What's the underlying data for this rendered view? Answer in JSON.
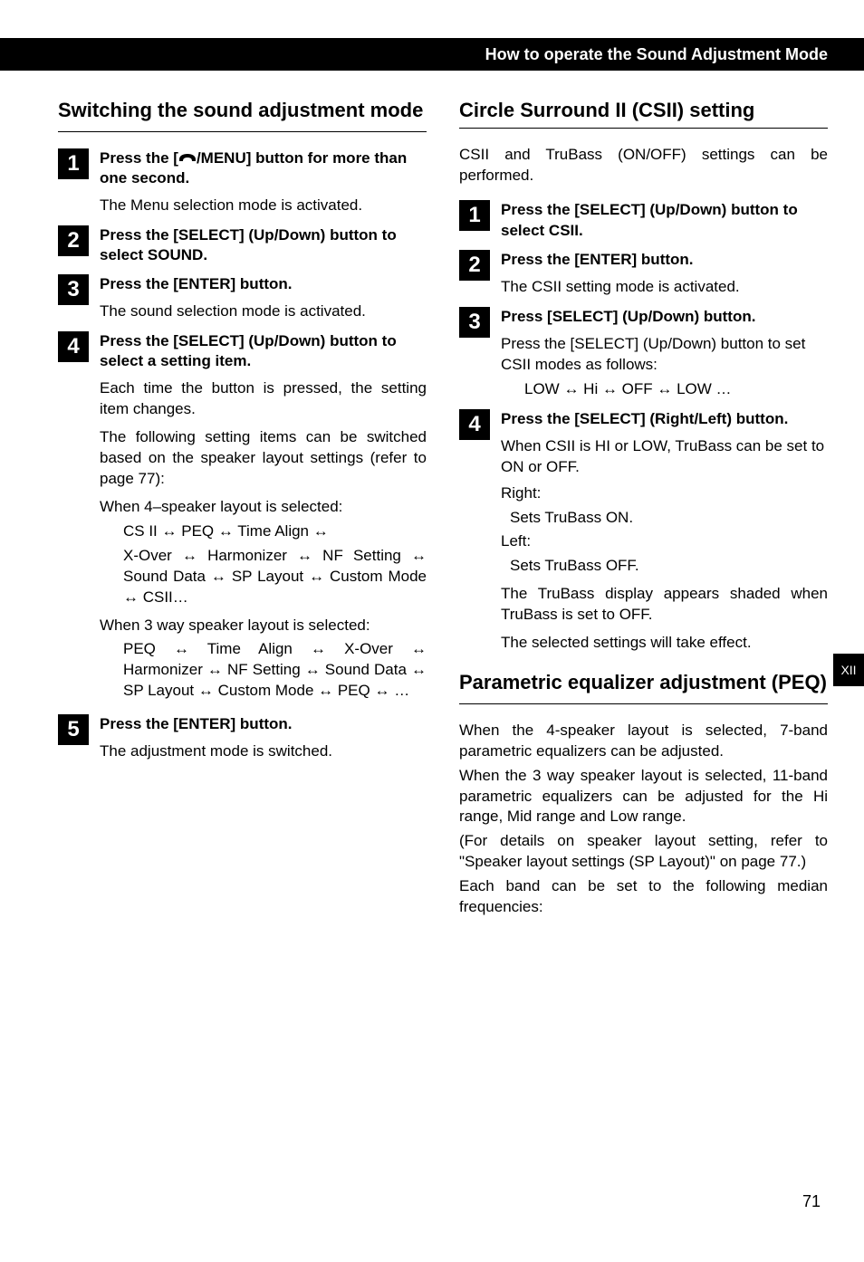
{
  "header": {
    "title": "How to operate the Sound Adjustment Mode"
  },
  "left": {
    "heading": "Switching the sound adjustment mode",
    "steps": {
      "s1": {
        "num": "1",
        "title_pre": "Press the [",
        "title_post": "/MENU] button for more than one second.",
        "t1": "The Menu selection mode is activated."
      },
      "s2": {
        "num": "2",
        "title": "Press the [SELECT] (Up/Down) button to select SOUND."
      },
      "s3": {
        "num": "3",
        "title": "Press the [ENTER] button.",
        "t1": "The sound selection mode is activated."
      },
      "s4": {
        "num": "4",
        "title": "Press the [SELECT] (Up/Down) button to select a setting item.",
        "t1": "Each time the button is pressed, the setting item changes.",
        "t2": "The following setting items can be switched based on the speaker layout settings (refer to page 77):",
        "t3": "When 4–speaker layout is selected:",
        "seq4_a": "CS II ↔ PEQ ↔ Time Align ↔",
        "seq4_b": "X-Over ↔ Harmonizer ↔ NF Setting ↔ Sound Data ↔ SP Layout ↔ Custom Mode ↔ CSII…",
        "t4": "When 3 way speaker layout is selected:",
        "seq3": "PEQ ↔ Time Align ↔ X-Over ↔ Harmonizer ↔ NF Setting ↔ Sound Data ↔ SP Layout ↔ Custom Mode ↔ PEQ ↔ …"
      },
      "s5": {
        "num": "5",
        "title": "Press the [ENTER] button.",
        "t1": "The adjustment mode is switched."
      }
    }
  },
  "right": {
    "sectA": {
      "heading": "Circle Surround II (CSII) setting",
      "intro": "CSII and TruBass (ON/OFF) settings can be performed.",
      "steps": {
        "s1": {
          "num": "1",
          "title": "Press the [SELECT] (Up/Down) button to select CSII."
        },
        "s2": {
          "num": "2",
          "title": "Press the [ENTER] button.",
          "t1": "The CSII setting mode is activated."
        },
        "s3": {
          "num": "3",
          "title": "Press [SELECT] (Up/Down) button.",
          "t1": "Press the [SELECT] (Up/Down) button to set CSII modes as follows:",
          "seq": "LOW ↔ Hi ↔ OFF ↔ LOW …"
        },
        "s4": {
          "num": "4",
          "title": "Press the [SELECT] (Right/Left) button.",
          "t1": "When CSII is HI or LOW, TruBass can be set to ON or OFF.",
          "r_label": "Right:",
          "r_text": "Sets TruBass ON.",
          "l_label": "Left:",
          "l_text": "Sets TruBass OFF.",
          "t2": "The TruBass display appears shaded when TruBass is set to OFF.",
          "t3": "The selected settings will take effect."
        }
      }
    },
    "sectB": {
      "heading": "Parametric equalizer adjustment (PEQ)",
      "p1": "When the 4-speaker layout is selected, 7-band parametric equalizers can be adjusted.",
      "p2": "When the 3 way speaker layout is selected, 11-band parametric equalizers can be adjusted for the Hi range, Mid range and Low range.",
      "p3": "(For details on speaker layout setting, refer to \"Speaker layout settings (SP Layout)\" on page 77.)",
      "p4": "Each band can be set to the following median frequencies:"
    }
  },
  "sidetab": "XII",
  "pagenum": "71"
}
